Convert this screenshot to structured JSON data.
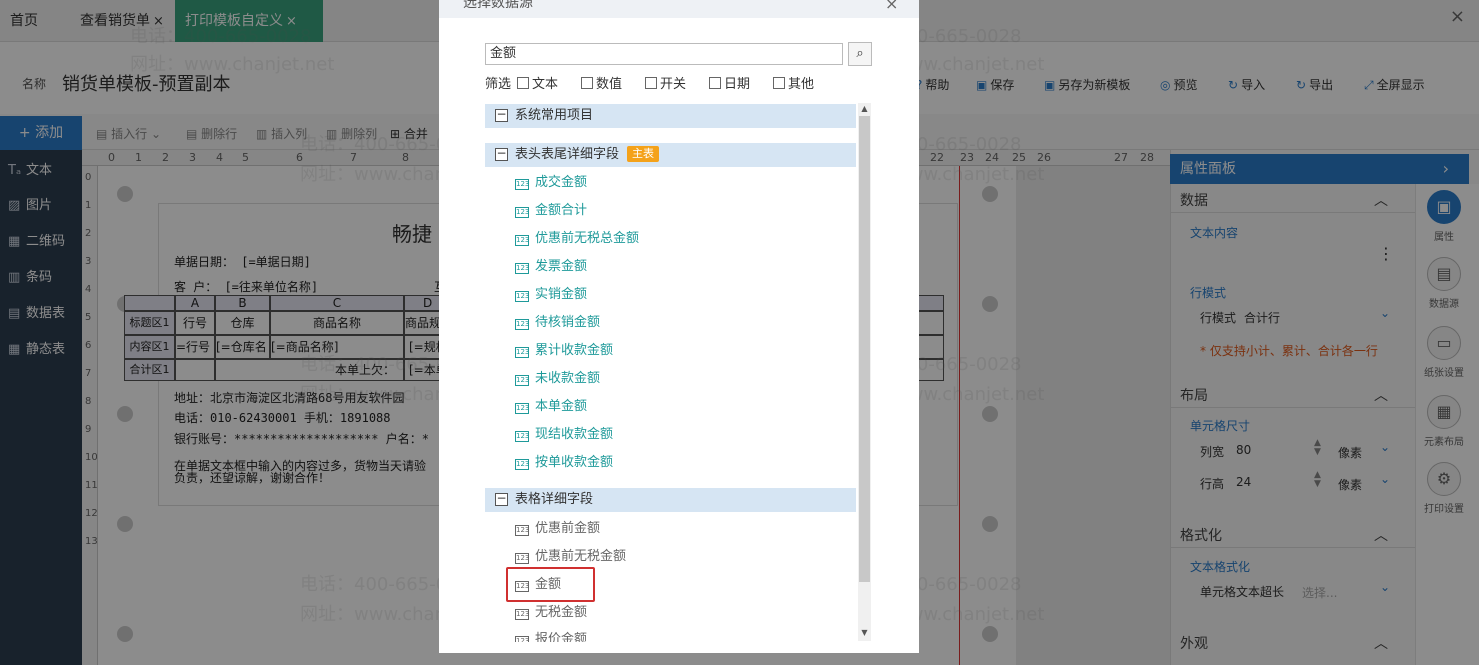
{
  "tabs": [
    {
      "label": "首页"
    },
    {
      "label": "查看销货单",
      "close": "×"
    },
    {
      "label": "打印模板自定义",
      "close": "×"
    }
  ],
  "tab_close_all": "×",
  "template": {
    "name_label": "名称",
    "name": "销货单模板-预置副本"
  },
  "right_buttons": [
    {
      "label": "帮助",
      "icon": "help-icon"
    },
    {
      "label": "保存",
      "icon": "save-icon"
    },
    {
      "label": "另存为新模板",
      "icon": "save-as-icon"
    },
    {
      "label": "预览",
      "icon": "preview-icon"
    },
    {
      "label": "导入",
      "icon": "import-icon"
    },
    {
      "label": "导出",
      "icon": "export-icon"
    },
    {
      "label": "全屏显示",
      "icon": "fullscreen-icon"
    }
  ],
  "toolbar": {
    "add": "添加",
    "insert_row": "插入行",
    "delete_row": "删除行",
    "insert_col": "插入列",
    "delete_col": "删除列",
    "merge": "合并"
  },
  "sidebar": [
    {
      "label": "文本",
      "icon": "text-icon"
    },
    {
      "label": "图片",
      "icon": "image-icon"
    },
    {
      "label": "二维码",
      "icon": "qrcode-icon"
    },
    {
      "label": "条码",
      "icon": "barcode-icon"
    },
    {
      "label": "数据表",
      "icon": "datatable-icon"
    },
    {
      "label": "静态表",
      "icon": "static-table-icon"
    }
  ],
  "ruler_top": [
    "0",
    "1",
    "2",
    "3",
    "4",
    "5",
    "6",
    "7",
    "8",
    "22",
    "23",
    "24",
    "25",
    "26",
    "27",
    "28"
  ],
  "ruler_left": [
    "0",
    "1",
    "2",
    "3",
    "4",
    "5",
    "6",
    "7",
    "8",
    "9",
    "10",
    "11",
    "12",
    "13"
  ],
  "document": {
    "title": "畅捷",
    "date_line": "单据日期： [=单据日期]",
    "customer_line": "客    户： [=往来单位名称]",
    "customer_tail": "互",
    "address": "地址：北京市海淀区北清路68号用友软件园",
    "phone": "电话：010-62430001      手机：1891088",
    "bank": "银行账号：********************   户名：*",
    "note1": "在单据文本框中输入的内容过多，货物当天请验",
    "note2": "负责，还望谅解，谢谢合作！"
  },
  "table": {
    "col_letters": [
      "A",
      "B",
      "C",
      "D"
    ],
    "row_labels": [
      "标题区1",
      "内容区1",
      "合计区1"
    ],
    "header_cells": [
      "行号",
      "仓库",
      "商品名称",
      "商品规"
    ],
    "content_cells": [
      "=行号",
      "[=仓库名",
      "[=商品名称]",
      "[=规格"
    ],
    "total_label": "本单上欠：",
    "total_value": "[=本单"
  },
  "watermark": {
    "phone": "电话：400-665-0028",
    "site": "网址：www.chanjet.net"
  },
  "property_panel": {
    "title": "属性面板",
    "sections": {
      "data": "数据",
      "text_content": "文本内容",
      "row_mode_sub": "行模式",
      "row_mode_label": "行模式",
      "row_mode_value": "合计行",
      "row_mode_note": "* 仅支持小计、累计、合计各一行",
      "layout": "布局",
      "cell_size": "单元格尺寸",
      "col_width_label": "列宽",
      "col_width_value": "80",
      "row_height_label": "行高",
      "row_height_value": "24",
      "unit": "像素",
      "format": "格式化",
      "text_format": "文本格式化",
      "overflow_label": "单元格文本超长",
      "overflow_placeholder": "选择...",
      "appearance": "外观"
    },
    "icons": [
      {
        "label": "属性",
        "icon": "property-icon",
        "active": true
      },
      {
        "label": "数据源",
        "icon": "datasource-icon"
      },
      {
        "label": "纸张设置",
        "icon": "paper-icon"
      },
      {
        "label": "元素布局",
        "icon": "layout-icon"
      },
      {
        "label": "打印设置",
        "icon": "print-settings-icon"
      }
    ]
  },
  "modal": {
    "title": "选择数据源",
    "close": "×",
    "search_value": "金额",
    "filter_label": "筛选",
    "filters": [
      "文本",
      "数值",
      "开关",
      "日期",
      "其他"
    ],
    "groups": [
      {
        "label": "系统常用项目"
      },
      {
        "label": "表头表尾详细字段",
        "badge": "主表"
      },
      {
        "label": "表格详细字段"
      }
    ],
    "header_fields": [
      "成交金额",
      "金额合计",
      "优惠前无税总金额",
      "发票金额",
      "实销金额",
      "待核销金额",
      "累计收款金额",
      "未收款金额",
      "本单金额",
      "现结收款金额",
      "按单收款金额"
    ],
    "table_fields": [
      "优惠前金额",
      "优惠前无税金额",
      "金额",
      "无税金额",
      "报价金额"
    ],
    "field_icon_text": "123"
  }
}
